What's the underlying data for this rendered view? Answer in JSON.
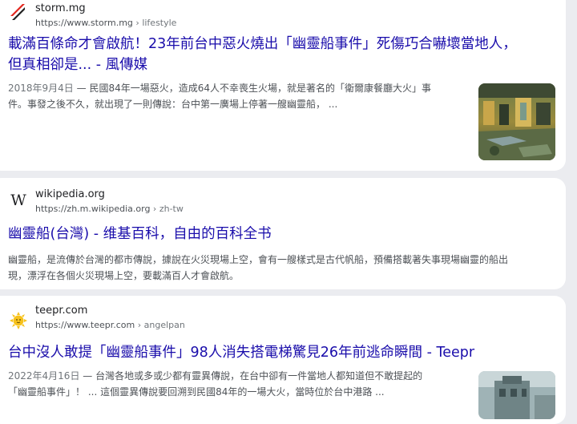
{
  "results": [
    {
      "site_name": "storm.mg",
      "url": "https://www.storm.mg",
      "breadcrumb": " › lifestyle",
      "title_line1": "載滿百條命才會啟航！23年前台中惡火燒出「幽靈船事件」死傷巧合嚇壞當地人，",
      "title_line2": "但真相卻是... - 風傳媒",
      "date": "2018年9月4日",
      "snippet_line1": " — 民國84年一場惡火，造成64人不幸喪生火場，就是著名的「衛爾康餐廳大火」事",
      "snippet_line2": "件。事發之後不久，就出現了一則傳說：台中第一廣場上停著一艘幽靈船， ...",
      "favicon": "storm-logo-icon",
      "thumbnail": "abandoned-building-thumbnail"
    },
    {
      "site_name": "wikipedia.org",
      "url": "https://zh.m.wikipedia.org",
      "breadcrumb": " › zh-tw",
      "favicon_text": "W",
      "title_line1": "幽靈船(台灣) - 维基百科，自由的百科全书",
      "snippet_line1": "幽靈船，是流傳於台灣的都市傳說，據說在火災現場上空，會有一艘樣式是古代帆船，預備搭載著失事現場幽靈的船出",
      "snippet_line2": "現，漂浮在各個火災現場上空，要載滿百人才會啟航。",
      "favicon": "wikipedia-logo-icon"
    },
    {
      "site_name": "teepr.com",
      "url": "https://www.teepr.com",
      "breadcrumb": " › angelpan",
      "title_line1": "台中沒人敢提「幽靈船事件」98人消失搭電梯驚見26年前逃命瞬間 - Teepr",
      "date": "2022年4月16日",
      "snippet_line1": " — 台灣各地或多或少都有靈異傳說，在台中卻有一件當地人都知道但不敢提起的",
      "snippet_line2": "「幽靈船事件」！ ... 這個靈異傳說要回溯到民國84年的一場大火，當時位於台中港路 ...",
      "favicon": "teepr-sun-logo-icon",
      "thumbnail": "building-photo-thumbnail"
    }
  ],
  "colors": {
    "link": "#1a0dab",
    "snippet": "#4d5156",
    "background": "#ebecf0",
    "card": "#ffffff",
    "storm_red": "#e2231a"
  }
}
